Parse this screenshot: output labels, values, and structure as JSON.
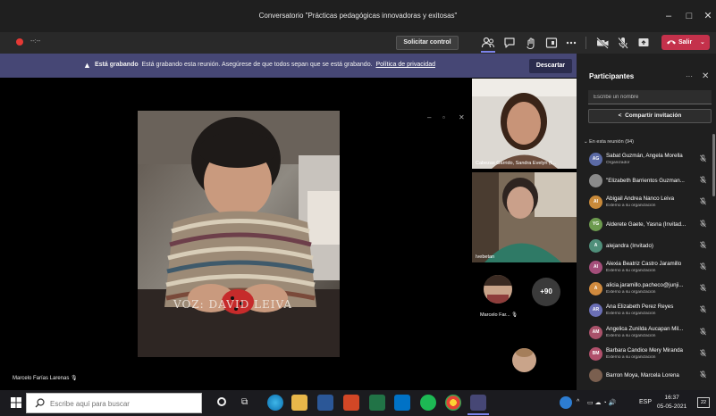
{
  "window": {
    "title": "Conversatorio \"Prácticas pedagógicas innovadoras y exitosas\"",
    "minimize_glyph": "–",
    "maximize_glyph": "□",
    "close_glyph": "✕"
  },
  "toolbar": {
    "recording_timer": "--:--",
    "request_control_label": "Solicitar control",
    "leave_label": "Salir",
    "leave_chevron": "⌄",
    "accent_color": "#c4314b"
  },
  "banner": {
    "icon": "warning-icon",
    "bold": "Está grabando",
    "text": "Está grabando esta reunión. Asegúrese de que todos sepan que se está grabando.",
    "link": "Política de privacidad",
    "dismiss_label": "Descartar",
    "color": "#464775"
  },
  "stage": {
    "watermark": "VOZ: DAVID LEIVA",
    "presenter_label": "Marcelo Farías Larenas",
    "tiles": [
      {
        "label": "Cabezas Garrido, Sandra Evelyn (I..."
      },
      {
        "label": "Ivebetan"
      },
      {
        "label": "Marcelo Far..."
      }
    ],
    "overflow_count": "+90"
  },
  "participants": {
    "title": "Participantes",
    "more_glyph": "···",
    "close_glyph": "✕",
    "search_placeholder": "Escribe un nombre",
    "share_label": "Compartir invitación",
    "in_meeting_header": "⌄ En esta reunión (94)",
    "people": [
      {
        "initials": "AG",
        "name": "Sabat Guzmán, Angela Morella",
        "sub": "Organizador",
        "color": "#5b6aa5"
      },
      {
        "initials": "",
        "name": "\"Elizabeth Barrientos Guzman...",
        "sub": "",
        "color": "#8a8a8a"
      },
      {
        "initials": "AI",
        "name": "Abigail Andrea Ñanco Leiva",
        "sub": "Externo a su organización",
        "color": "#c98a3a"
      },
      {
        "initials": "YG",
        "name": "Alderete Gaete, Yasna (Invitad...",
        "sub": "",
        "color": "#6c9a4e"
      },
      {
        "initials": "A",
        "name": "alejandra (Invitado)",
        "sub": "",
        "color": "#4f8f7a"
      },
      {
        "initials": "AI",
        "name": "Alexia Beatriz Castro Jaramillo",
        "sub": "Externo a su organización",
        "color": "#a44e7a"
      },
      {
        "initials": "A",
        "name": "alicia.jaramillo.pacheco@junji...",
        "sub": "Externo a su organización",
        "color": "#d08a3e"
      },
      {
        "initials": "AR",
        "name": "Ana Elizabeth Perez Reyes",
        "sub": "Externo a su organización",
        "color": "#6b6fb5"
      },
      {
        "initials": "AM",
        "name": "Angelica Zunilda Aucapan Mil...",
        "sub": "Externo a su organización",
        "color": "#a9526a"
      },
      {
        "initials": "BM",
        "name": "Barbara Candice Mery Miranda",
        "sub": "Externo a su organización",
        "color": "#b0506b"
      },
      {
        "initials": "",
        "name": "Barron Moya, Marcela Lorena",
        "sub": "",
        "color": "#7a5f4f"
      }
    ]
  },
  "taskbar": {
    "search_placeholder": "Escribe aquí para buscar",
    "language": "ESP",
    "time": "16:37",
    "date": "05-05-2021",
    "notification_count": "22"
  }
}
